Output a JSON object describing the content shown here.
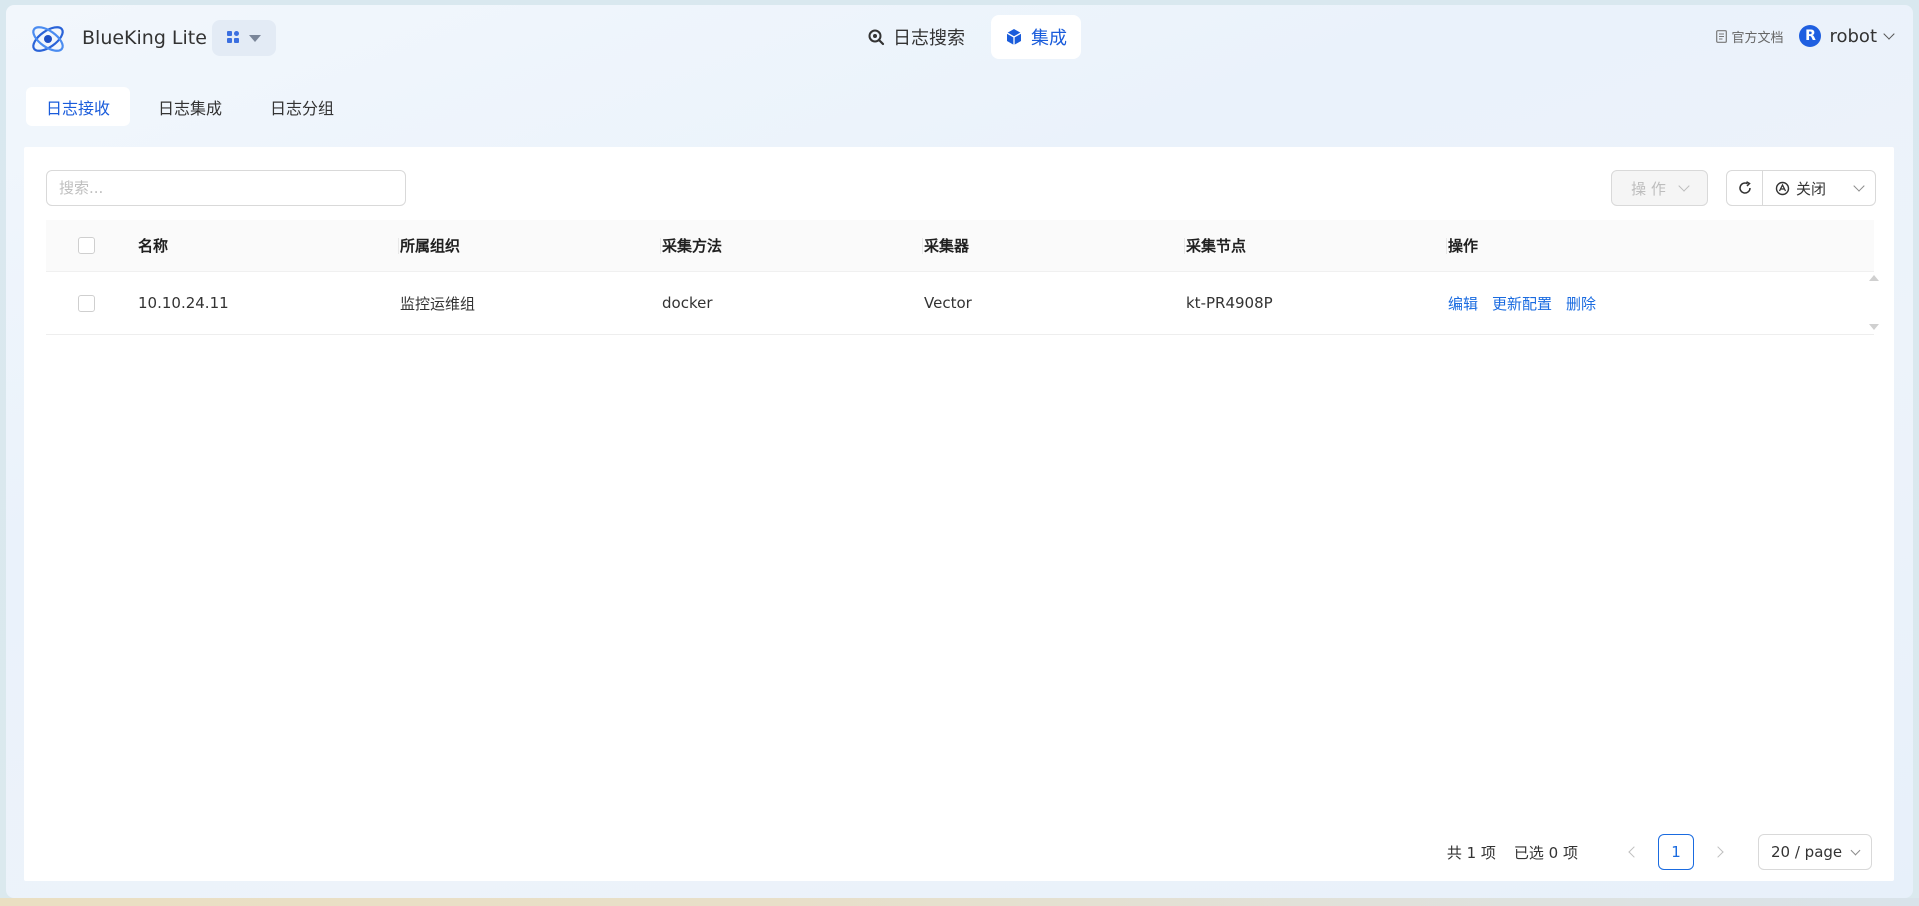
{
  "app": {
    "title": "BlueKing Lite",
    "logo_icon": "blueking-logo-icon",
    "switcher_icon": "app-grid-icon"
  },
  "nav": {
    "items": [
      {
        "label": "日志搜索",
        "icon": "search-icon",
        "active": false
      },
      {
        "label": "集成",
        "icon": "cube-icon",
        "active": true
      }
    ]
  },
  "header_right": {
    "docs_label": "官方文档",
    "user_initial": "R",
    "user_name": "robot"
  },
  "subtabs": [
    {
      "label": "日志接收",
      "active": true
    },
    {
      "label": "日志集成",
      "active": false
    },
    {
      "label": "日志分组",
      "active": false
    }
  ],
  "toolbar": {
    "search_placeholder": "搜索...",
    "ops_label": "操 作",
    "auto_refresh_label": "关闭"
  },
  "table": {
    "columns": [
      "名称",
      "所属组织",
      "采集方法",
      "采集器",
      "采集节点",
      "操作"
    ],
    "rows": [
      {
        "name": "10.10.24.11",
        "org": "监控运维组",
        "method": "docker",
        "collector": "Vector",
        "node": "kt-PR4908P",
        "actions": [
          "编辑",
          "更新配置",
          "删除"
        ]
      }
    ]
  },
  "pagination": {
    "total": "共 1 项",
    "selected": "已选 0 项",
    "current_page": "1",
    "page_size": "20 / page"
  },
  "colors": {
    "accent": "#1a6be0",
    "avatar": "#1f5fe0"
  }
}
